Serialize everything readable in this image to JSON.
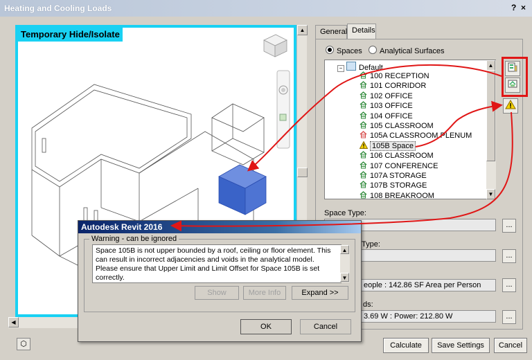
{
  "window": {
    "title": "Heating and Cooling Loads",
    "help": "?",
    "close": "×"
  },
  "viewport": {
    "label": "Temporary Hide/Isolate"
  },
  "tabs": [
    {
      "label": "General"
    },
    {
      "label": "Details"
    }
  ],
  "analysis_mode": {
    "spaces_label": "Spaces",
    "surfaces_label": "Analytical Surfaces",
    "selected": "Spaces"
  },
  "tree": {
    "root": "Default",
    "items": [
      {
        "label": "100 RECEPTION",
        "icon": "space-house-icon"
      },
      {
        "label": "101 CORRIDOR",
        "icon": "space-house-icon"
      },
      {
        "label": "102 OFFICE",
        "icon": "space-house-icon"
      },
      {
        "label": "103 OFFICE",
        "icon": "space-house-icon"
      },
      {
        "label": "104 OFFICE",
        "icon": "space-house-icon"
      },
      {
        "label": "105 CLASSROOM",
        "icon": "space-house-icon"
      },
      {
        "label": "105A CLASSROOM PLENUM",
        "icon": "plenum-house-icon"
      },
      {
        "label": "105B Space",
        "icon": "warning-icon"
      },
      {
        "label": "106 CLASSROOM",
        "icon": "space-house-icon"
      },
      {
        "label": "107 CONFERENCE",
        "icon": "space-house-icon"
      },
      {
        "label": "107A STORAGE",
        "icon": "space-house-icon"
      },
      {
        "label": "107B STORAGE",
        "icon": "space-house-icon"
      },
      {
        "label": "108 BREAKROOM",
        "icon": "space-house-icon"
      }
    ]
  },
  "side_tools": [
    "highlight-space-icon",
    "isolate-space-icon",
    "warning-icon"
  ],
  "fields": {
    "space_type_label": "Space Type:",
    "construction_type_label": "Type:",
    "people_label": "",
    "people_value": "eople : 142.86 SF Area per Person",
    "loads_label": "ds:",
    "loads_value": "3.69 W : Power: 212.80 W",
    "browse": "..."
  },
  "footer": {
    "calculate": "Calculate",
    "save_settings": "Save Settings",
    "cancel": "Cancel"
  },
  "dialog": {
    "title": "Autodesk Revit 2016",
    "group_label": "Warning - can be ignored",
    "message": "Space 105B is not upper bounded by a roof, ceiling or floor element. This can result in incorrect adjacencies and voids in the analytical model. Please ensure that Upper Limit and Limit Offset for Space 105B is set correctly.",
    "show": "Show",
    "more_info": "More Info",
    "expand": "Expand >>",
    "ok": "OK",
    "cancel": "Cancel"
  },
  "colors": {
    "highlight": "#19d1f3",
    "annotation": "#e01616",
    "selection_box": "#3a63c8"
  }
}
